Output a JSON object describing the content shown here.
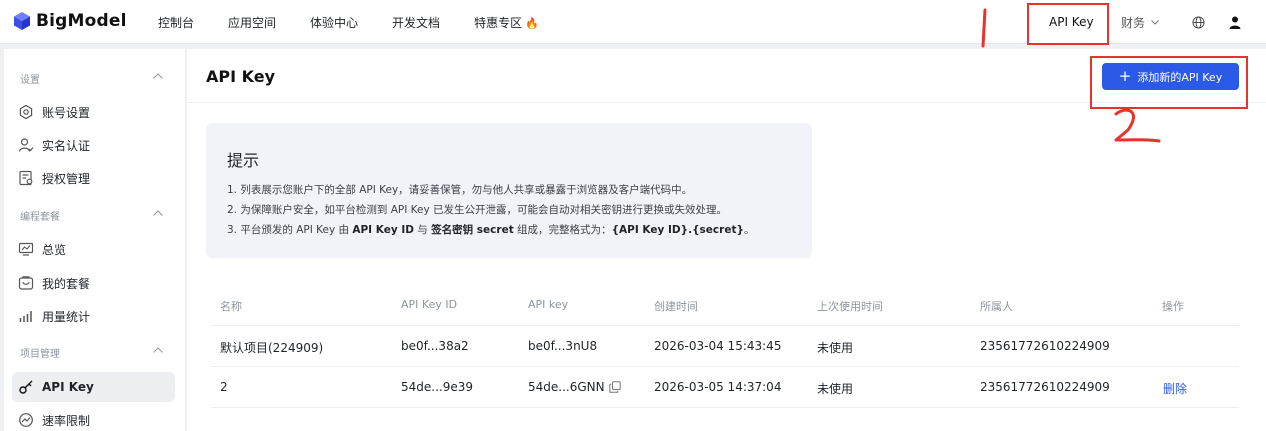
{
  "brand": {
    "name": "BigModel"
  },
  "nav": {
    "links": [
      "控制台",
      "应用空间",
      "体验中心",
      "开发文档",
      "特惠专区"
    ],
    "promo_icon": "🔥",
    "api_key": "API Key",
    "finance": "财务"
  },
  "annotations": {
    "mark1": "1",
    "mark2": "2",
    "color": "#e8322b"
  },
  "sidebar": {
    "sections": [
      {
        "title": "设置",
        "items": [
          "账号设置",
          "实名认证",
          "授权管理"
        ]
      },
      {
        "title": "编程套餐",
        "items": [
          "总览",
          "我的套餐",
          "用量统计"
        ]
      },
      {
        "title": "项目管理",
        "items": [
          "API Key",
          "速率限制"
        ]
      }
    ],
    "active": "API Key"
  },
  "page": {
    "title": "API Key",
    "add_button": "添加新的API Key",
    "accent": "#2b59e8"
  },
  "tip": {
    "title": "提示",
    "line1": "1. 列表展示您账户下的全部 API Key，请妥善保管，勿与他人共享或暴露于浏览器及客户端代码中。",
    "line2": "2. 为保障账户安全，如平台检测到 API Key 已发生公开泄露，可能会自动对相关密钥进行更换或失效处理。",
    "line3_a": "3. 平台颁发的 API Key 由 ",
    "line3_b": "API Key ID",
    "line3_c": " 与 ",
    "line3_d": "签名密钥 secret",
    "line3_e": " 组成，完整格式为：",
    "line3_f": "{API Key ID}.{secret}",
    "line3_g": "。"
  },
  "table": {
    "columns": [
      "名称",
      "API Key ID",
      "API key",
      "创建时间",
      "上次使用时间",
      "所属人",
      "操作"
    ],
    "rows": [
      {
        "name": "默认项目(224909)",
        "key_id": "be0f...38a2",
        "api_key": "be0f...3nU8",
        "created": "2026-03-04 15:43:45",
        "last_used": "未使用",
        "owner": "23561772610224909",
        "action": ""
      },
      {
        "name": "2",
        "key_id": "54de...9e39",
        "api_key": "54de...6GNN",
        "created": "2026-03-05 14:37:04",
        "last_used": "未使用",
        "owner": "23561772610224909",
        "action": "删除"
      }
    ]
  }
}
